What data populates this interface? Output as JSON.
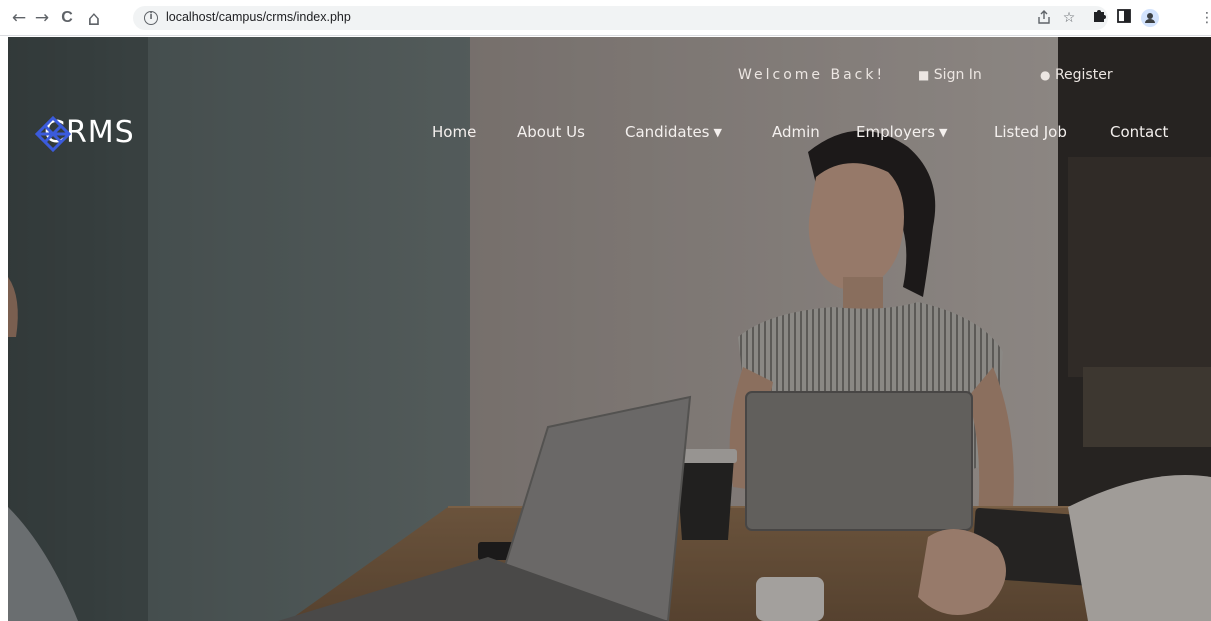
{
  "browser": {
    "url": "localhost/campus/crms/index.php",
    "back_icon": "←",
    "forward_icon": "→",
    "reload_icon": "C",
    "home_icon": "⌂"
  },
  "site": {
    "logo_text": "CRMS",
    "topbar": {
      "welcome": "Welcome Back!",
      "sign_in": "Sign In",
      "register": "Register"
    },
    "nav": {
      "home": "Home",
      "about": "About Us",
      "candidates": "Candidates",
      "admin": "Admin",
      "employers": "Employers",
      "listed_job": "Listed Job",
      "contact": "Contact"
    }
  },
  "colors": {
    "logo_accent": "#3b5bdb",
    "nav_text": "#f4f0ee"
  }
}
